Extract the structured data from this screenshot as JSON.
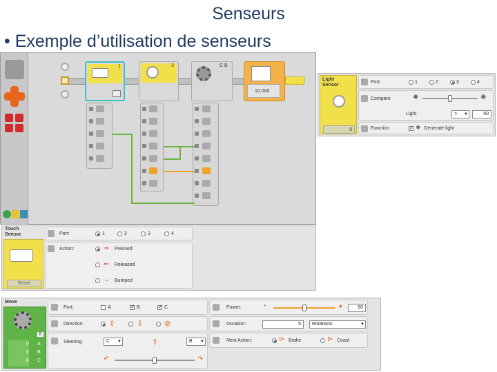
{
  "slide": {
    "title": "Senseurs",
    "bullet": "• Exemple d’utilisation de senseurs"
  },
  "program": {
    "blocks": [
      {
        "name": "touch-sensor-block",
        "port": "1"
      },
      {
        "name": "light-sensor-block",
        "port": "3"
      },
      {
        "name": "move-block",
        "ports": "C B"
      },
      {
        "name": "wait-block",
        "value": "10.000"
      }
    ]
  },
  "light_panel": {
    "title_line1": "Light",
    "title_line2": "Sensor",
    "port_label": "Port:",
    "ports": [
      "1",
      "2",
      "3",
      "4"
    ],
    "selected_port": "3",
    "compare_label": "Compare",
    "light_label": "Light",
    "compare_operator": ">",
    "compare_value": "50",
    "compare_level": 0.5,
    "function_label": "Function",
    "generate_light_label": "Generate light",
    "generate_light": true,
    "display_value": "0"
  },
  "touch_panel": {
    "title_line1": "Touch",
    "title_line2": "Sensor",
    "port_label": "Port:",
    "ports": [
      "1",
      "2",
      "3",
      "4"
    ],
    "selected_port": "1",
    "action_label": "Action:",
    "actions": [
      "Pressed",
      "Released",
      "Bumped"
    ],
    "selected_action": "Pressed",
    "reset_label": "Reset"
  },
  "move_panel": {
    "title": "Move",
    "port_label": "Port:",
    "ports": [
      "A",
      "B",
      "C"
    ],
    "selected_ports": [
      "B",
      "C"
    ],
    "direction_label": "Direction:",
    "steering_label": "Steering:",
    "steering_left": "C",
    "steering_right": "B",
    "steering_level": 0.5,
    "power_label": "Power:",
    "power_value": "50",
    "power_level": 0.5,
    "duration_label": "Duration:",
    "duration_value": "5",
    "duration_unit": "Rotations",
    "next_action_label": "Next Action:",
    "next_actions": [
      "Brake",
      "Coast"
    ],
    "selected_next_action": "Brake",
    "feedback": [
      "B",
      "0",
      "0",
      "0"
    ],
    "feedback_letters": [
      "A",
      "B",
      "C"
    ]
  },
  "colors": {
    "accent_yellow": "#f1e04a",
    "palette_orange": "#e8651e",
    "palette_red": "#d22b2b",
    "block_green": "#5fb347",
    "title_blue": "#1f3a60",
    "wire_green": "#6cb33f",
    "wire_orange": "#f0a22a"
  }
}
